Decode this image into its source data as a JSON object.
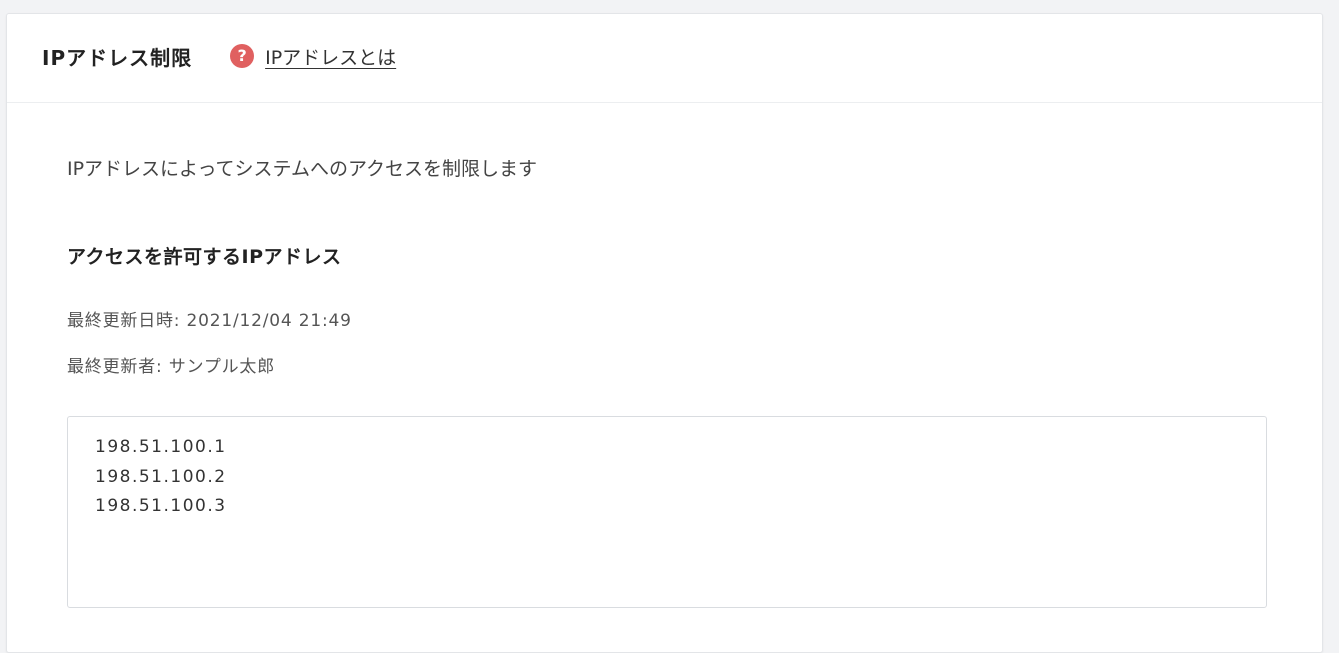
{
  "header": {
    "title": "IPアドレス制限",
    "help_icon": "question-circle-icon",
    "help_link_label": "IPアドレスとは",
    "help_icon_color": "#e06060"
  },
  "main": {
    "description": "IPアドレスによってシステムへのアクセスを制限します",
    "section_title": "アクセスを許可するIPアドレス",
    "last_updated_label": "最終更新日時: ",
    "last_updated_value": "2021/12/04 21:49",
    "last_updated_by_label": "最終更新者: ",
    "last_updated_by_value": "サンプル太郎",
    "ip_addresses": [
      "198.51.100.1",
      "198.51.100.2",
      "198.51.100.3"
    ]
  }
}
